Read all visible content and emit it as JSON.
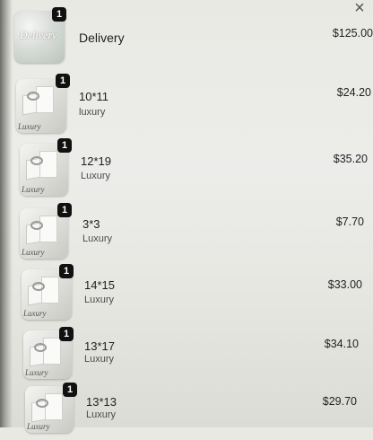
{
  "close_icon": "×",
  "items": [
    {
      "name": "Delivery",
      "variant": "",
      "price": "$125.00",
      "qty": "1",
      "thumb_text": "Delivery"
    },
    {
      "name": "10*11",
      "variant": "luxury",
      "price": "$24.20",
      "qty": "1",
      "thumb_text": "Luxury"
    },
    {
      "name": "12*19",
      "variant": "Luxury",
      "price": "$35.20",
      "qty": "1",
      "thumb_text": "Luxury"
    },
    {
      "name": "3*3",
      "variant": "Luxury",
      "price": "$7.70",
      "qty": "1",
      "thumb_text": "Luxury"
    },
    {
      "name": "14*15",
      "variant": "Luxury",
      "price": "$33.00",
      "qty": "1",
      "thumb_text": "Luxury"
    },
    {
      "name": "13*17",
      "variant": "Luxury",
      "price": "$34.10",
      "qty": "1",
      "thumb_text": "Luxury"
    },
    {
      "name": "13*13",
      "variant": "Luxury",
      "price": "$29.70",
      "qty": "1",
      "thumb_text": "Luxury"
    }
  ]
}
